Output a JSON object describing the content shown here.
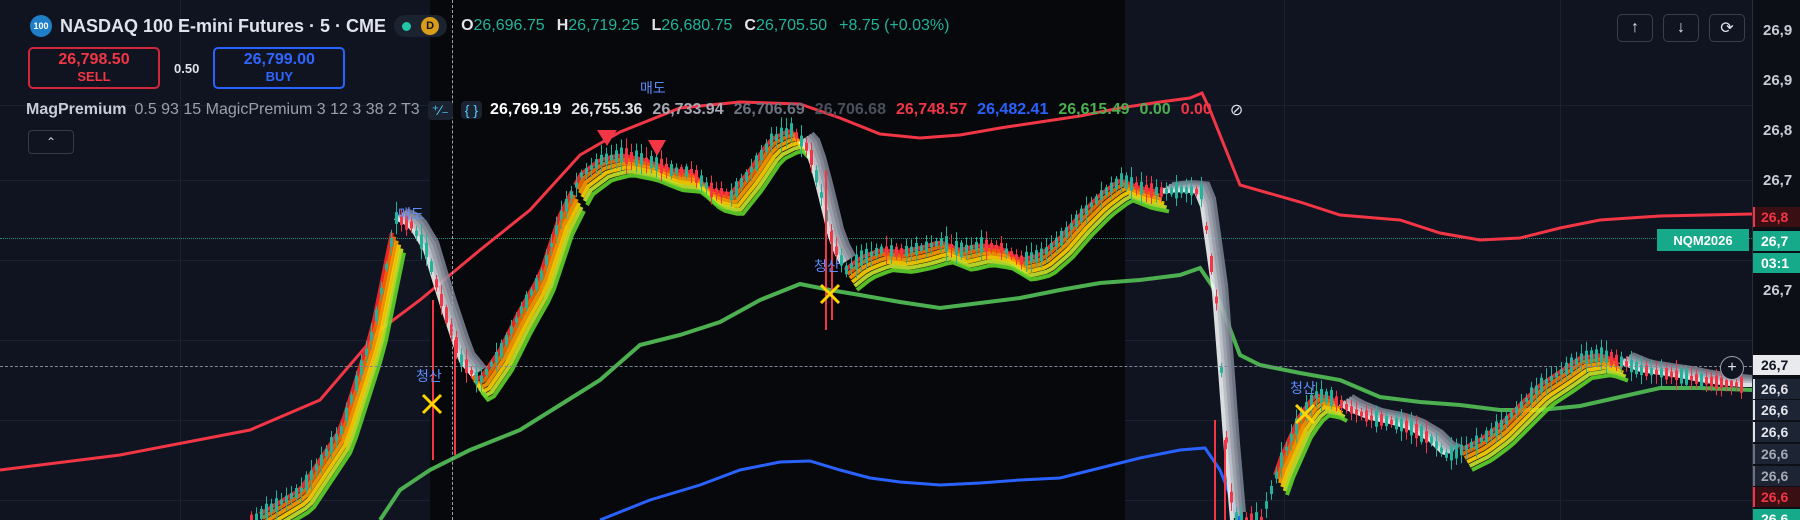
{
  "symbol": {
    "logo_text": "100",
    "title": "NASDAQ 100 E-mini Futures · 5 · CME",
    "status_badge": "D",
    "ohlc": [
      {
        "key": "O",
        "value": "26,696.75"
      },
      {
        "key": "H",
        "value": "26,719.25"
      },
      {
        "key": "L",
        "value": "26,680.75"
      },
      {
        "key": "C",
        "value": "26,705.50"
      }
    ],
    "change": "+8.75 (+0.03%)"
  },
  "trade": {
    "sell_price": "26,798.50",
    "sell_label": "SELL",
    "spread": "0.50",
    "buy_price": "26,799.00",
    "buy_label": "BUY"
  },
  "indicator": {
    "name": "MagPremium",
    "params": "0.5 93 15 MagicPremium 3 12 3 38 2 T3",
    "values": [
      {
        "text": "26,769.19",
        "color": "#ffffff"
      },
      {
        "text": "26,755.36",
        "color": "#e0e3eb"
      },
      {
        "text": "26,733.94",
        "color": "#a3a8b4"
      },
      {
        "text": "26,706.69",
        "color": "#6c7280"
      },
      {
        "text": "26,706.68",
        "color": "#4a4f5c"
      },
      {
        "text": "26,748.57",
        "color": "#f23645"
      },
      {
        "text": "26,482.41",
        "color": "#2962ff"
      },
      {
        "text": "26,615.49",
        "color": "#4caf50"
      },
      {
        "text": "0.00",
        "color": "#4caf50"
      },
      {
        "text": "0.00",
        "color": "#f23645"
      }
    ]
  },
  "toolbar": {
    "up_icon": "↑",
    "down_icon": "↓",
    "loop_icon": "⟳",
    "collapse_icon": "⌃"
  },
  "chart_labels": {
    "sell_top": "매도",
    "sell_left": "매도",
    "close_1": "청산",
    "close_2": "청산",
    "close_3": "청산"
  },
  "contract_badge": "NQM2026",
  "price_scale": {
    "ticks": [
      {
        "text": "26,9",
        "top": 0
      },
      {
        "text": "26,9",
        "top": 0
      },
      {
        "text": "26,8",
        "top": 0
      },
      {
        "text": "26,7",
        "top": 0
      },
      {
        "text": "26,7",
        "top": 0
      }
    ],
    "labels": [
      {
        "text": "26,8",
        "bg": "#3a0f14",
        "fg": "#f23645",
        "border": "#f23645"
      },
      {
        "text": "26,7",
        "bg": "#16a98a",
        "fg": "#ffffff",
        "border": "#16a98a"
      },
      {
        "text": "03:1",
        "bg": "#16a98a",
        "fg": "#ffffff",
        "border": "#16a98a"
      },
      {
        "text": "26,7",
        "bg": "#e8eaed",
        "fg": "#101420",
        "border": "#e8eaed"
      },
      {
        "text": "26,6",
        "bg": "#1d2433",
        "fg": "#e0e3eb",
        "border": "#e0e3eb"
      },
      {
        "text": "26,6",
        "bg": "#1d2433",
        "fg": "#e0e3eb",
        "border": "#e0e3eb"
      },
      {
        "text": "26,6",
        "bg": "#1d2433",
        "fg": "#e0e3eb",
        "border": "#e0e3eb"
      },
      {
        "text": "26,6",
        "bg": "#1d2433",
        "fg": "#a3a8b4",
        "border": "#6c7280"
      },
      {
        "text": "26,6",
        "bg": "#1d2433",
        "fg": "#a3a8b4",
        "border": "#6c7280"
      },
      {
        "text": "26,6",
        "bg": "#3a0f14",
        "fg": "#f23645",
        "border": "#f23645"
      },
      {
        "text": "26,6",
        "bg": "#16a98a",
        "fg": "#ffffff",
        "border": "#16a98a"
      }
    ]
  },
  "colors": {
    "up": "#22b39a",
    "down": "#f23645",
    "upper_band": "#f23645",
    "mid_band": "#4caf50",
    "lower_band": "#2962ff"
  }
}
